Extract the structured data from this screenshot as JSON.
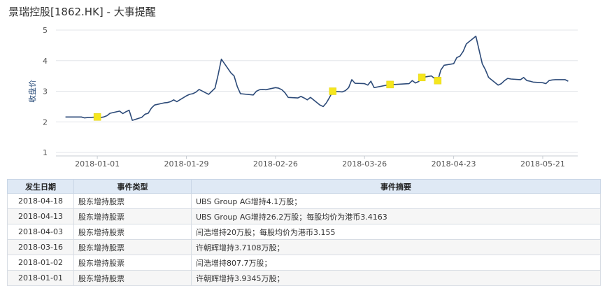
{
  "page": {
    "title": "景瑞控股[1862.HK] - 大事提醒"
  },
  "chart_data": {
    "type": "line",
    "title": "",
    "xlabel": "",
    "ylabel": "收盘价",
    "ylim": [
      1,
      5
    ],
    "yticks": [
      1,
      2,
      3,
      4,
      5
    ],
    "xticks": [
      "2018-01-01",
      "2018-01-29",
      "2018-02-26",
      "2018-03-26",
      "2018-04-23",
      "2018-05-21"
    ],
    "grid": true,
    "series": [
      {
        "name": "",
        "color": "#2c4a78",
        "points": [
          [
            "2017-12-22",
            2.16
          ],
          [
            "2017-12-27",
            2.16
          ],
          [
            "2017-12-28",
            2.13
          ],
          [
            "2017-12-29",
            2.14
          ],
          [
            "2018-01-01",
            2.16
          ],
          [
            "2018-01-02",
            2.14
          ],
          [
            "2018-01-03",
            2.16
          ],
          [
            "2018-01-04",
            2.2
          ],
          [
            "2018-01-05",
            2.28
          ],
          [
            "2018-01-08",
            2.35
          ],
          [
            "2018-01-09",
            2.27
          ],
          [
            "2018-01-10",
            2.33
          ],
          [
            "2018-01-11",
            2.38
          ],
          [
            "2018-01-12",
            2.05
          ],
          [
            "2018-01-15",
            2.15
          ],
          [
            "2018-01-16",
            2.25
          ],
          [
            "2018-01-17",
            2.28
          ],
          [
            "2018-01-18",
            2.45
          ],
          [
            "2018-01-19",
            2.55
          ],
          [
            "2018-01-22",
            2.62
          ],
          [
            "2018-01-23",
            2.63
          ],
          [
            "2018-01-24",
            2.66
          ],
          [
            "2018-01-25",
            2.72
          ],
          [
            "2018-01-26",
            2.66
          ],
          [
            "2018-01-29",
            2.85
          ],
          [
            "2018-01-30",
            2.9
          ],
          [
            "2018-01-31",
            2.92
          ],
          [
            "2018-02-01",
            2.97
          ],
          [
            "2018-02-02",
            3.06
          ],
          [
            "2018-02-05",
            2.9
          ],
          [
            "2018-02-06",
            3.0
          ],
          [
            "2018-02-07",
            3.1
          ],
          [
            "2018-02-08",
            3.55
          ],
          [
            "2018-02-09",
            4.05
          ],
          [
            "2018-02-12",
            3.6
          ],
          [
            "2018-02-13",
            3.5
          ],
          [
            "2018-02-14",
            3.15
          ],
          [
            "2018-02-15",
            2.92
          ],
          [
            "2018-02-19",
            2.88
          ],
          [
            "2018-02-20",
            3.0
          ],
          [
            "2018-02-21",
            3.05
          ],
          [
            "2018-02-22",
            3.06
          ],
          [
            "2018-02-23",
            3.05
          ],
          [
            "2018-02-26",
            3.12
          ],
          [
            "2018-02-27",
            3.1
          ],
          [
            "2018-02-28",
            3.05
          ],
          [
            "2018-03-01",
            2.95
          ],
          [
            "2018-03-02",
            2.8
          ],
          [
            "2018-03-05",
            2.78
          ],
          [
            "2018-03-06",
            2.83
          ],
          [
            "2018-03-07",
            2.78
          ],
          [
            "2018-03-08",
            2.72
          ],
          [
            "2018-03-09",
            2.8
          ],
          [
            "2018-03-12",
            2.55
          ],
          [
            "2018-03-13",
            2.5
          ],
          [
            "2018-03-14",
            2.62
          ],
          [
            "2018-03-15",
            2.8
          ],
          [
            "2018-03-16",
            3.0
          ],
          [
            "2018-03-19",
            2.98
          ],
          [
            "2018-03-20",
            3.02
          ],
          [
            "2018-03-21",
            3.12
          ],
          [
            "2018-03-22",
            3.38
          ],
          [
            "2018-03-23",
            3.26
          ],
          [
            "2018-03-26",
            3.25
          ],
          [
            "2018-03-27",
            3.2
          ],
          [
            "2018-03-28",
            3.33
          ],
          [
            "2018-03-29",
            3.12
          ],
          [
            "2018-04-03",
            3.22
          ],
          [
            "2018-04-04",
            3.22
          ],
          [
            "2018-04-09",
            3.25
          ],
          [
            "2018-04-10",
            3.35
          ],
          [
            "2018-04-11",
            3.27
          ],
          [
            "2018-04-12",
            3.32
          ],
          [
            "2018-04-13",
            3.45
          ],
          [
            "2018-04-16",
            3.5
          ],
          [
            "2018-04-17",
            3.42
          ],
          [
            "2018-04-18",
            3.35
          ],
          [
            "2018-04-19",
            3.7
          ],
          [
            "2018-04-20",
            3.85
          ],
          [
            "2018-04-23",
            3.9
          ],
          [
            "2018-04-24",
            4.1
          ],
          [
            "2018-04-25",
            4.15
          ],
          [
            "2018-04-26",
            4.3
          ],
          [
            "2018-04-27",
            4.55
          ],
          [
            "2018-04-30",
            4.8
          ],
          [
            "2018-05-02",
            3.9
          ],
          [
            "2018-05-03",
            3.7
          ],
          [
            "2018-05-04",
            3.45
          ],
          [
            "2018-05-07",
            3.2
          ],
          [
            "2018-05-08",
            3.25
          ],
          [
            "2018-05-09",
            3.35
          ],
          [
            "2018-05-10",
            3.42
          ],
          [
            "2018-05-11",
            3.4
          ],
          [
            "2018-05-14",
            3.38
          ],
          [
            "2018-05-15",
            3.45
          ],
          [
            "2018-05-16",
            3.35
          ],
          [
            "2018-05-17",
            3.33
          ],
          [
            "2018-05-18",
            3.3
          ],
          [
            "2018-05-21",
            3.28
          ],
          [
            "2018-05-22",
            3.25
          ],
          [
            "2018-05-23",
            3.35
          ],
          [
            "2018-05-24",
            3.37
          ],
          [
            "2018-05-25",
            3.38
          ],
          [
            "2018-05-28",
            3.38
          ],
          [
            "2018-05-29",
            3.33
          ]
        ]
      }
    ],
    "event_markers": [
      {
        "date": "2018-01-01",
        "value": 2.16,
        "color": "#f5e61e"
      },
      {
        "date": "2018-03-16",
        "value": 3.0,
        "color": "#f5e61e"
      },
      {
        "date": "2018-04-03",
        "value": 3.22,
        "color": "#f5e61e"
      },
      {
        "date": "2018-04-13",
        "value": 3.45,
        "color": "#f5e61e"
      },
      {
        "date": "2018-04-18",
        "value": 3.35,
        "color": "#f5e61e"
      }
    ]
  },
  "table": {
    "headers": [
      "发生日期",
      "事件类型",
      "事件摘要"
    ],
    "rows": [
      [
        "2018-04-18",
        "股东增持股票",
        "UBS Group AG增持4.1万股；"
      ],
      [
        "2018-04-13",
        "股东增持股票",
        "UBS Group AG增持26.2万股；每股均价为港币3.4163"
      ],
      [
        "2018-04-03",
        "股东增持股票",
        "闫浩增持20万股；每股均价为港币3.155"
      ],
      [
        "2018-03-16",
        "股东增持股票",
        "许朝辉增持3.7108万股；"
      ],
      [
        "2018-01-02",
        "股东增持股票",
        "闫浩增持807.7万股；"
      ],
      [
        "2018-01-01",
        "股东增持股票",
        "许朝辉增持3.9345万股；"
      ]
    ]
  }
}
